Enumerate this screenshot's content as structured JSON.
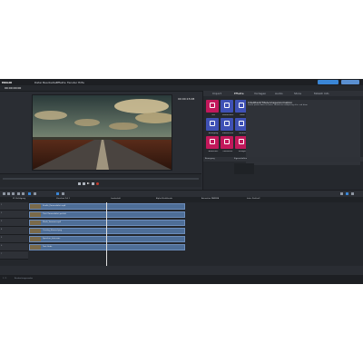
{
  "app": {
    "title": "MAGIX",
    "menu": [
      "Datei",
      "Bearbeiten",
      "Effekte",
      "Fenster",
      "Hilfe"
    ],
    "accent": "#3a86d6"
  },
  "transport": {
    "timecode_left": "00:00:00:00",
    "timecode_right": "00:00:15:08",
    "project_title": "Projektvorlage: Kamerafahrt perfekt 1"
  },
  "right_panel": {
    "tabs": [
      "Import",
      "Effekte",
      "Vorlagen",
      "Audio",
      "Store",
      "MAGIX Info"
    ],
    "active_tab": "Effekte",
    "description_title": "Intellitext/Titelvorlage/Animation",
    "description_text": "Lorem ipsum dolor sit amet, consetetur sadipscing elitr, sed diam",
    "tiles": [
      {
        "label": "Titel",
        "color": "#c2185b",
        "icon": "text-icon"
      },
      {
        "label": "Videoeffekte",
        "color": "#3f51b5",
        "icon": "palette-icon"
      },
      {
        "label": "Farbe",
        "color": "#3f51b5",
        "icon": "sun-icon"
      },
      {
        "label": "Bewegung",
        "color": "#3f51b5",
        "icon": "move-icon"
      },
      {
        "label": "Stabilisieren",
        "color": "#3f51b5",
        "icon": "flash-icon"
      },
      {
        "label": "Schärfe",
        "color": "#3f51b5",
        "icon": "pen-icon"
      },
      {
        "label": "Ausschnitt",
        "color": "#c2185b",
        "icon": "crop-icon"
      },
      {
        "label": "Überblend.",
        "color": "#c2185b",
        "icon": "square-icon"
      },
      {
        "label": "Vorlagen",
        "color": "#c2185b",
        "icon": "target-icon"
      }
    ],
    "sub_label": "Bewegung",
    "sub_tab": "Eigenschaften"
  },
  "timeline": {
    "chapters": [
      "01 Verfolgung",
      "Vorschau Teil 1",
      "Landschaft",
      "Alpha Rückblende",
      "Animation KAMERA",
      "Intro: Kraftvoll"
    ],
    "tracks": [
      "1",
      "2",
      "3",
      "4",
      "5",
      "6",
      "7"
    ],
    "clips": [
      {
        "label": "Straße_Kamerafahrt.mp4",
        "track": 1
      },
      {
        "label": "Titel: Kamerafahrt perfekt",
        "track": 2
      },
      {
        "label": "Musik_Sommer.mp3",
        "track": 3
      },
      {
        "label": "Overlay_Himmel.png",
        "track": 4
      },
      {
        "label": "Sprecher_Intro.wav",
        "track": 5
      },
      {
        "label": "Text: Ende",
        "track": 6
      }
    ],
    "zoom": "1 / 1",
    "status": "Bearbeitungsmodus"
  }
}
